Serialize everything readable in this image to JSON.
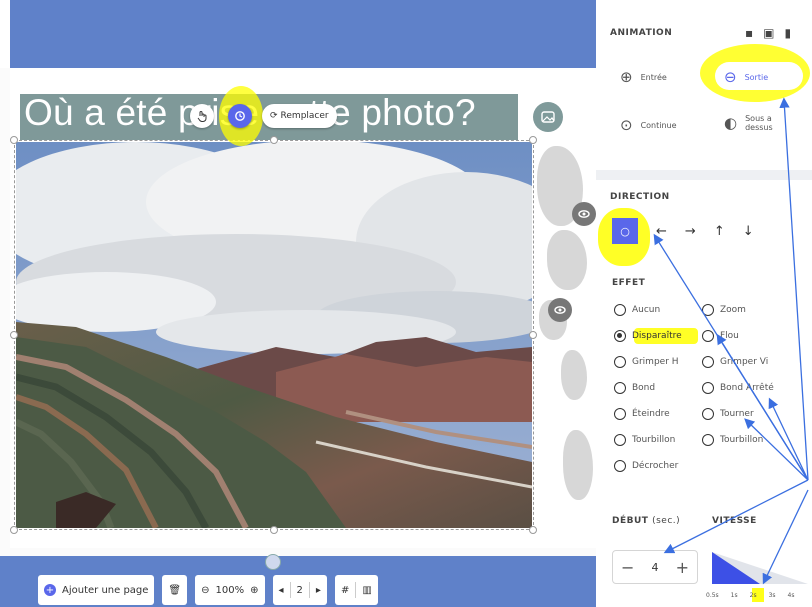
{
  "slide": {
    "title": "Où a été prise cette photo?",
    "replace_label": "Remplacer"
  },
  "bottom_toolbar": {
    "add_page_label": "Ajouter une page",
    "zoom_value": "100%",
    "page_number": "2"
  },
  "panel": {
    "animation_header": "ANIMATION",
    "animation_options": {
      "entree": "Entrée",
      "sortie": "Sortie",
      "continue": "Continue",
      "sous_dessus": "Sous a dessus"
    },
    "direction_header": "DIRECTION",
    "effect_header": "EFFET",
    "effects_left": [
      "Aucun",
      "Disparaître",
      "Grimper H",
      "Bond",
      "Éteindre",
      "Tourbillon",
      "Décrocher"
    ],
    "effects_right": [
      "Zoom",
      "Flou",
      "Grimper Vi",
      "Bond Arrêté",
      "Tourner",
      "Tourbillon"
    ],
    "selected_effect": "Disparaître",
    "debut_header": "DÉBUT",
    "debut_unit": "(sec.)",
    "debut_value": "4",
    "vitesse_header": "VITESSE",
    "speed_ticks": [
      "0.5s",
      "1s",
      "2s",
      "3s",
      "4s"
    ],
    "selected_speed": "2s"
  },
  "colors": {
    "topbar": "#5f81c9",
    "accent": "#5a67ea",
    "highlight": "#ffff00",
    "annotation_arrow": "#3b6fe0"
  },
  "icons": [
    "touch-icon",
    "camera-icon",
    "refresh-icon",
    "image-icon",
    "eye-icon",
    "plus-circle-icon",
    "trash-icon",
    "zoom-out-icon",
    "zoom-in-icon",
    "prev-icon",
    "next-icon",
    "grid-icon",
    "layout-icon",
    "copy-icon",
    "calendar-icon",
    "delete-icon",
    "entry-icon",
    "exit-icon",
    "continue-icon",
    "flip-icon",
    "arrow-left-icon",
    "arrow-right-icon",
    "arrow-up-icon",
    "arrow-down-icon"
  ]
}
